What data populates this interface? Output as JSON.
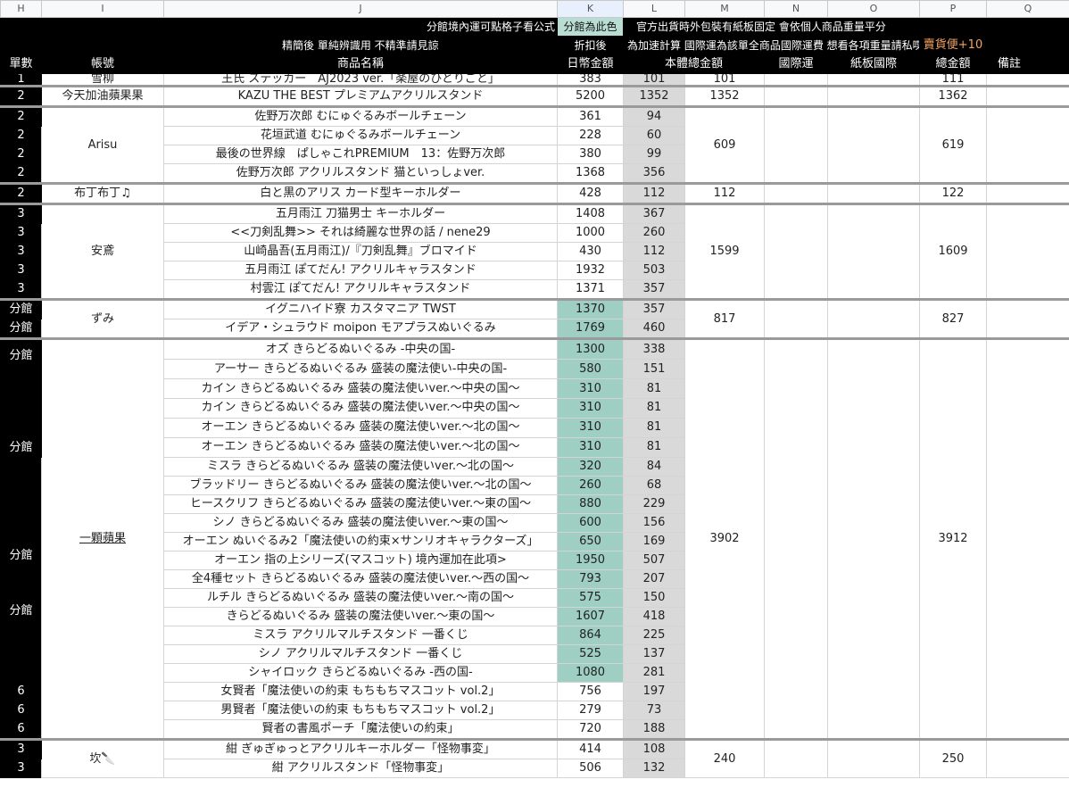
{
  "colLetters": [
    "H",
    "I",
    "J",
    "K",
    "L",
    "M",
    "N",
    "O",
    "P",
    "Q"
  ],
  "header": {
    "row1": {
      "note": "分館境內運可點格子看公式",
      "highlight": "分館為此色",
      "right": "官方出貨時外包裝有紙板固定 會依個人商品重量平分"
    },
    "row2": {
      "note": "精簡後 單純辨識用 不精準請見諒",
      "k": "折扣後",
      "lm": "為加速計算 國際運為該單全商品國際運費 想看各項重量請私喋",
      "bonus": "賣貨便+10"
    },
    "row3": [
      "單數",
      "帳號",
      "商品名稱",
      "日幣金額",
      "本體總金額",
      "",
      "國際運",
      "紙板國際",
      "總金額",
      "備註"
    ]
  },
  "rows": {
    "r1": {
      "h": "1",
      "i": "雪柳",
      "j": "王氏 ステッカー　AJ2023 ver.「楽屋のひとりごと」",
      "k": "383",
      "l": "101",
      "m": "101",
      "p": "111"
    },
    "r2": {
      "h": "2",
      "i": "今天加油蘋果果",
      "j": "KAZU THE BEST プレミアムアクリルスタンド",
      "k": "5200",
      "l": "1352",
      "m": "1352",
      "p": "1362"
    },
    "g3": {
      "i": "Arisu",
      "m": "609",
      "p": "619",
      "items": [
        {
          "h": "2",
          "j": "佐野万次郎 むにゅぐるみボールチェーン",
          "k": "361",
          "l": "94"
        },
        {
          "h": "2",
          "j": "花垣武道 むにゅぐるみボールチェーン",
          "k": "228",
          "l": "60"
        },
        {
          "h": "2",
          "j": "最後の世界線　ぱしゃこれPREMIUM　13：佐野万次郎",
          "k": "380",
          "l": "99"
        },
        {
          "h": "2",
          "j": "佐野万次郎 アクリルスタンド 猫といっしょver.",
          "k": "1368",
          "l": "356"
        }
      ]
    },
    "r7": {
      "h": "2",
      "i": "布丁布丁♫",
      "j": "白と黒のアリス カード型キーホルダー",
      "k": "428",
      "l": "112",
      "m": "112",
      "p": "122"
    },
    "g4": {
      "i": "安鳶",
      "m": "1599",
      "p": "1609",
      "items": [
        {
          "h": "3",
          "j": "五月雨江 刀猫男士 キーホルダー",
          "k": "1408",
          "l": "367"
        },
        {
          "h": "3",
          "j": "<<刀剣乱舞>> それは綺麗な世界の話 / nene29",
          "k": "1000",
          "l": "260"
        },
        {
          "h": "3",
          "j": "山崎晶吾(五月雨江)/『刀剣乱舞』ブロマイド",
          "k": "430",
          "l": "112"
        },
        {
          "h": "3",
          "j": "五月雨江 ぽてだん! アクリルキャラスタンド",
          "k": "1932",
          "l": "503"
        },
        {
          "h": "3",
          "j": "村雲江 ぽてだん! アクリルキャラスタンド",
          "k": "1371",
          "l": "357"
        }
      ]
    },
    "g5": {
      "i": "ずみ",
      "m": "817",
      "p": "827",
      "items": [
        {
          "h": "分館",
          "j": "イグニハイド寮 カスタマニア TWST",
          "k": "1370",
          "l": "357"
        },
        {
          "h": "分館",
          "j": "イデア・シュラウド moipon モアプラスぬいぐるみ",
          "k": "1769",
          "l": "460"
        }
      ]
    },
    "g6": {
      "i": "一顆蘋果",
      "m": "3902",
      "p": "3912",
      "labels": {
        "a": "分館",
        "b": "分館",
        "c": "分館",
        "d": "分館",
        "e": "6",
        "f": "6",
        "g": "6"
      },
      "items": [
        {
          "j": "オズ きらどるぬいぐるみ -中央の国-",
          "k": "1300",
          "l": "338"
        },
        {
          "j": "アーサー きらどるぬいぐるみ 盛装の魔法使い-中央の国-",
          "k": "580",
          "l": "151"
        },
        {
          "j": "カイン きらどるぬいぐるみ 盛装の魔法使いver.～中央の国～",
          "k": "310",
          "l": "81"
        },
        {
          "j": "カイン きらどるぬいぐるみ 盛装の魔法使いver.～中央の国～",
          "k": "310",
          "l": "81"
        },
        {
          "j": "オーエン きらどるぬいぐるみ 盛装の魔法使いver.～北の国～",
          "k": "310",
          "l": "81"
        },
        {
          "j": "オーエン きらどるぬいぐるみ 盛装の魔法使いver.～北の国～",
          "k": "310",
          "l": "81"
        },
        {
          "j": "ミスラ きらどるぬいぐるみ 盛装の魔法使いver.～北の国～",
          "k": "320",
          "l": "84"
        },
        {
          "j": "ブラッドリー きらどるぬいぐるみ 盛装の魔法使いver.～北の国～",
          "k": "260",
          "l": "68"
        },
        {
          "j": "ヒースクリフ きらどるぬいぐるみ 盛装の魔法使いver.～東の国～",
          "k": "880",
          "l": "229"
        },
        {
          "j": "シノ きらどるぬいぐるみ 盛装の魔法使いver.～東の国～",
          "k": "600",
          "l": "156"
        },
        {
          "j": "オーエン ぬいぐるみ2「魔法使いの約束×サンリオキャラクターズ」",
          "k": "650",
          "l": "169"
        },
        {
          "j": "オーエン 指の上シリーズ(マスコット) 境內運加在此項>",
          "k": "1950",
          "l": "507"
        },
        {
          "j": "全4種セット きらどるぬいぐるみ 盛装の魔法使いver.～西の国～",
          "k": "793",
          "l": "207"
        },
        {
          "j": "ルチル きらどるぬいぐるみ 盛装の魔法使いver.～南の国～",
          "k": "575",
          "l": "150"
        },
        {
          "j": "きらどるぬいぐるみ 盛装の魔法使いver.～東の国～",
          "k": "1607",
          "l": "418"
        },
        {
          "j": "ミスラ アクリルマルチスタンド 一番くじ",
          "k": "864",
          "l": "225"
        },
        {
          "j": "シノ アクリルマルチスタンド 一番くじ",
          "k": "525",
          "l": "137"
        },
        {
          "j": "シャイロック きらどるぬいぐるみ -西の国-",
          "k": "1080",
          "l": "281"
        },
        {
          "j": "女賢者「魔法使いの約束 もちもちマスコット vol.2」",
          "k": "756",
          "l": "197"
        },
        {
          "j": "男賢者「魔法使いの約束 もちもちマスコット vol.2」",
          "k": "279",
          "l": "73"
        },
        {
          "j": "賢者の書風ポーチ「魔法使いの約束」",
          "k": "720",
          "l": "188"
        }
      ]
    },
    "g7": {
      "i": "坎🔪",
      "m": "240",
      "p": "250",
      "items": [
        {
          "h": "3",
          "j": "紺 ぎゅぎゅっとアクリルキーホルダー「怪物事変」",
          "k": "414",
          "l": "108"
        },
        {
          "h": "3",
          "j": "紺 アクリルスタンド「怪物事変」",
          "k": "506",
          "l": "132"
        }
      ]
    }
  }
}
